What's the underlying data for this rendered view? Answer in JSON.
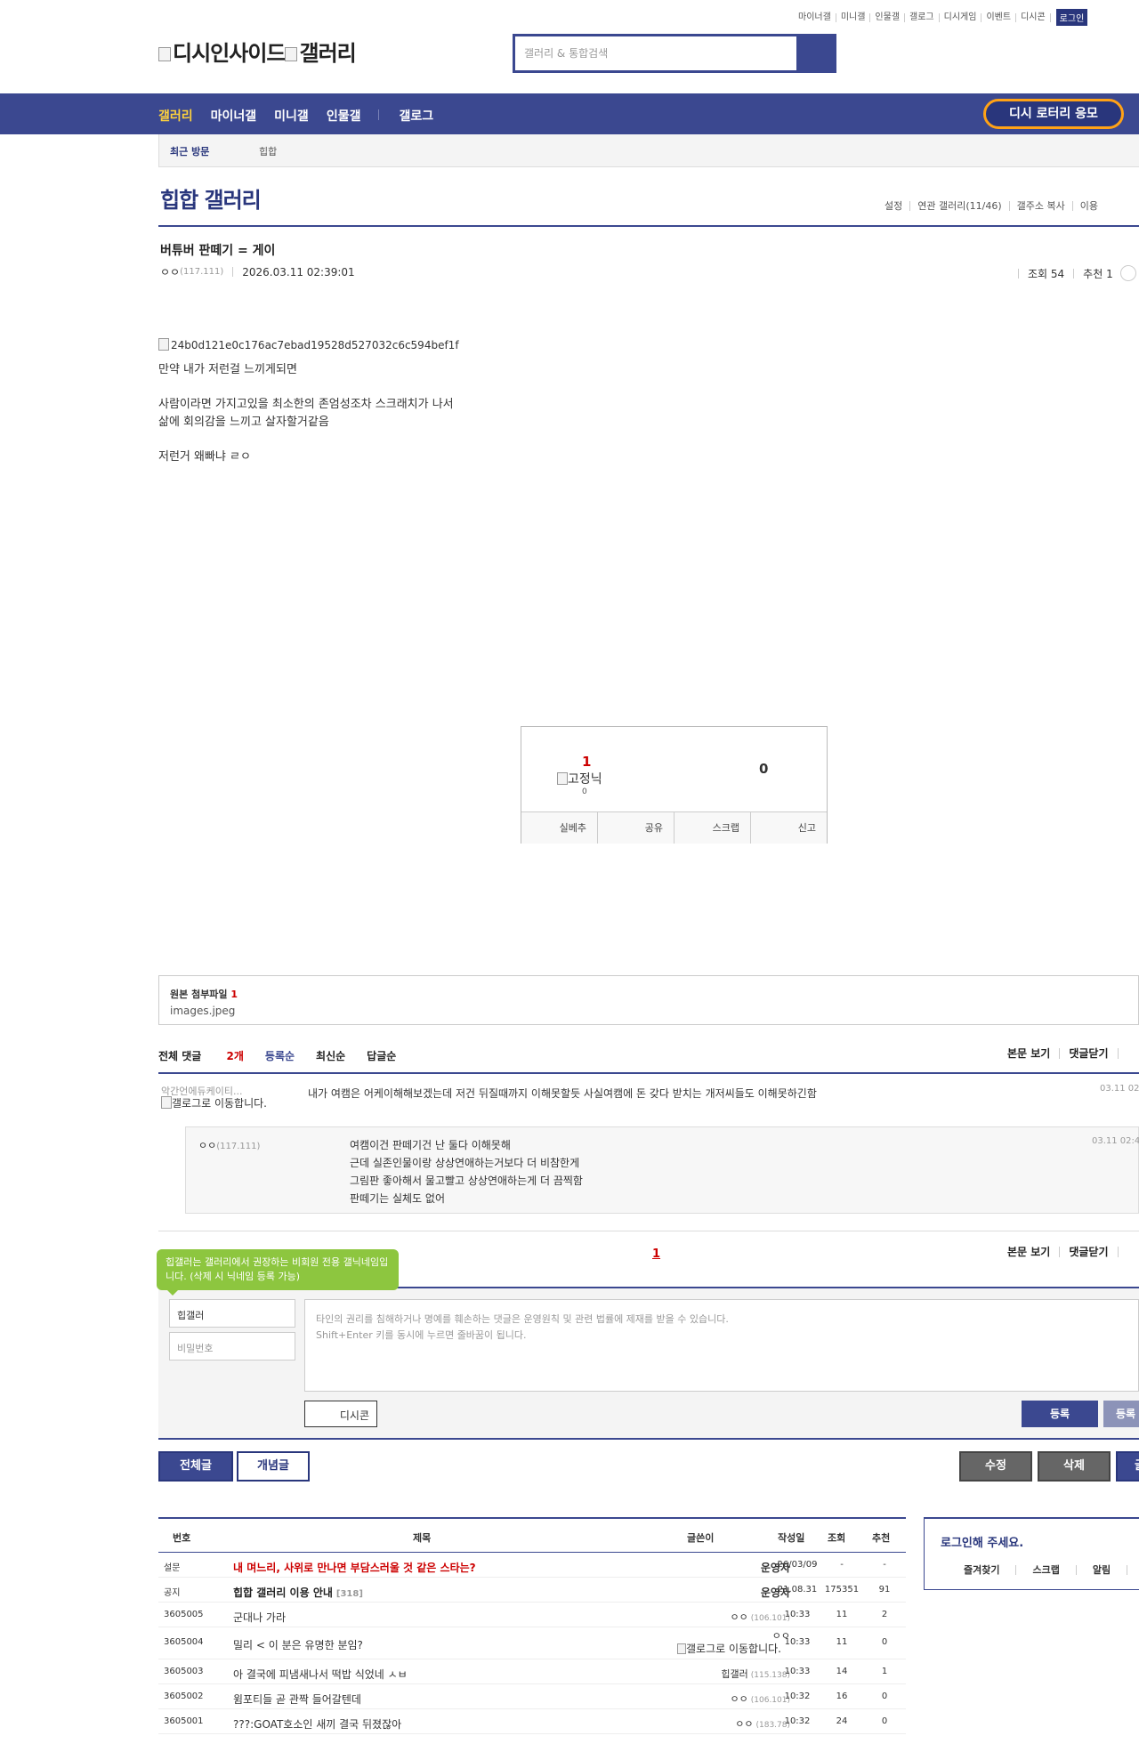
{
  "util_nav": [
    "마이너갤",
    "미니갤",
    "인물갤",
    "갤로그",
    "디시게임",
    "이벤트",
    "디시콘"
  ],
  "login_label": "로그인",
  "logo_text": "디시인사이드",
  "logo_text2": "갤러리",
  "search_placeholder": "갤러리 & 통합검색",
  "main_nav": [
    "갤러리",
    "마이너갤",
    "미니갤",
    "인물갤",
    "갤로그"
  ],
  "lottery_label": "디시 로터리 응모",
  "recent": {
    "label": "최근 방문",
    "gallery": "힙합"
  },
  "gallery_title": "힙합 갤러리",
  "gallery_menu": [
    "설정",
    "연관 갤러리(11/46)",
    "갤주소 복사",
    "이용"
  ],
  "post": {
    "title": "버튜버 판떼기 = 게이",
    "writer": "ㅇㅇ",
    "ip": "(117.111)",
    "date": "2026.03.11 02:39:01",
    "views": "조회 54",
    "recommend": "추천 1",
    "image_alt": "24b0d121e0c176ac7ebad19528d527032c6c594bef1f",
    "lines": [
      "만약 내가 저런걸 느끼게되면",
      "사람이라면 가지고있을 최소한의 존엄성조차 스크래치가 나서",
      "삶에 회의감을 느끼고 살자할거같음",
      "저런거 왜빠냐 ㄹㅇ"
    ]
  },
  "recommend_box": {
    "up_count": "1",
    "gojung_label": "고정닉",
    "gojung_count": "0",
    "down_count": "0",
    "buttons": [
      "실베추",
      "공유",
      "스크랩",
      "신고"
    ]
  },
  "attach": {
    "label": "원본 첨부파일",
    "count": "1",
    "file": "images.jpeg"
  },
  "comments": {
    "total_label": "전체 댓글",
    "total_count": "2개",
    "sorts": [
      "등록순",
      "최신순",
      "답글순"
    ],
    "right_menu": [
      "본문 보기",
      "댓글닫기"
    ],
    "c1": {
      "nick": "악간언에듀케이티...",
      "alt": "갤로그로 이동합니다.",
      "text": "내가 여캠은 어케이해해보겠는데 저건 뒤질때까지 이해못할듯 사실여캠에 돈 갖다 받치는 개저씨들도 이해못하긴함",
      "date": "03.11 02"
    },
    "reply": {
      "nick": "ㅇㅇ",
      "ip": "(117.111)",
      "lines": [
        "여캠이건 판떼기건 난 둘다 이해못해",
        "근데 실존인물이랑 상상연애하는거보다 더 비참한게",
        "그림판 좋아해서 물고빨고 상상연애하는게 더 끔찍함",
        "판떼기는 실체도 없어"
      ],
      "date": "03.11 02:4"
    },
    "page": "1"
  },
  "write": {
    "tip": "힙갤러는 갤러리에서 권장하는 비회원 전용 갤닉네임입니다. (삭제 시 닉네임 등록 가능)",
    "nick": "힙갤러",
    "pw_placeholder": "비밀번호",
    "notice": "타인의 권리를 침해하거나 명예를 훼손하는 댓글은 운영원칙 및 관련 법률에 제재를 받을 수 있습니다.",
    "notice2": "Shift+Enter 키를 동시에 누르면 줄바꿈이 됩니다.",
    "dccon": "디시콘",
    "register": "등록",
    "register2": "등록"
  },
  "bottom_buttons": {
    "all": "전체글",
    "concept": "개념글",
    "edit": "수정",
    "delete": "삭제",
    "write": "글"
  },
  "list_header": {
    "num": "번호",
    "title": "제목",
    "writer": "글쓴이",
    "date": "작성일",
    "views": "조회",
    "rec": "추천"
  },
  "list": [
    {
      "num": "설문",
      "title": "내 며느리, 사위로 만나면 부담스러울 것 같은 스타는?",
      "cnt": "",
      "writer": "운영자",
      "ip": "",
      "date": "26/03/09",
      "views": "-",
      "rec": "-"
    },
    {
      "num": "공지",
      "title": "힙합 갤러리 이용 안내",
      "cnt": "[318]",
      "writer": "운영자",
      "ip": "",
      "date": "21.08.31",
      "views": "175351",
      "rec": "91"
    },
    {
      "num": "3605005",
      "title": "군대나 가라",
      "cnt": "",
      "writer": "ㅇㅇ",
      "ip": "(106.101)",
      "date": "10:33",
      "views": "11",
      "rec": "2"
    },
    {
      "num": "3605004",
      "title": "밀리 < 이 분은 유명한 분임?",
      "cnt": "",
      "writer": "ㅇㅇ",
      "ip": "",
      "alt": "갤로그로 이동합니다.",
      "date": "10:33",
      "views": "11",
      "rec": "0"
    },
    {
      "num": "3605003",
      "title": "아 결국에 피냄새나서 떡밥 식었네 ㅅㅂ",
      "cnt": "",
      "writer": "힙갤러",
      "ip": "(115.138)",
      "date": "10:33",
      "views": "14",
      "rec": "1"
    },
    {
      "num": "3605002",
      "title": "윔포티들 곧 관짝 들어갈텐데",
      "cnt": "",
      "writer": "ㅇㅇ",
      "ip": "(106.101)",
      "date": "10:32",
      "views": "16",
      "rec": "0"
    },
    {
      "num": "3605001",
      "title": "???:GOAT호소인 새끼 결국 뒤졌잖아",
      "cnt": "",
      "writer": "ㅇㅇ",
      "ip": "(183.78)",
      "date": "10:32",
      "views": "24",
      "rec": "0"
    }
  ],
  "loginbox": {
    "title": "로그인해 주세요.",
    "menu": [
      "즐겨찾기",
      "스크랩",
      "알림"
    ]
  }
}
